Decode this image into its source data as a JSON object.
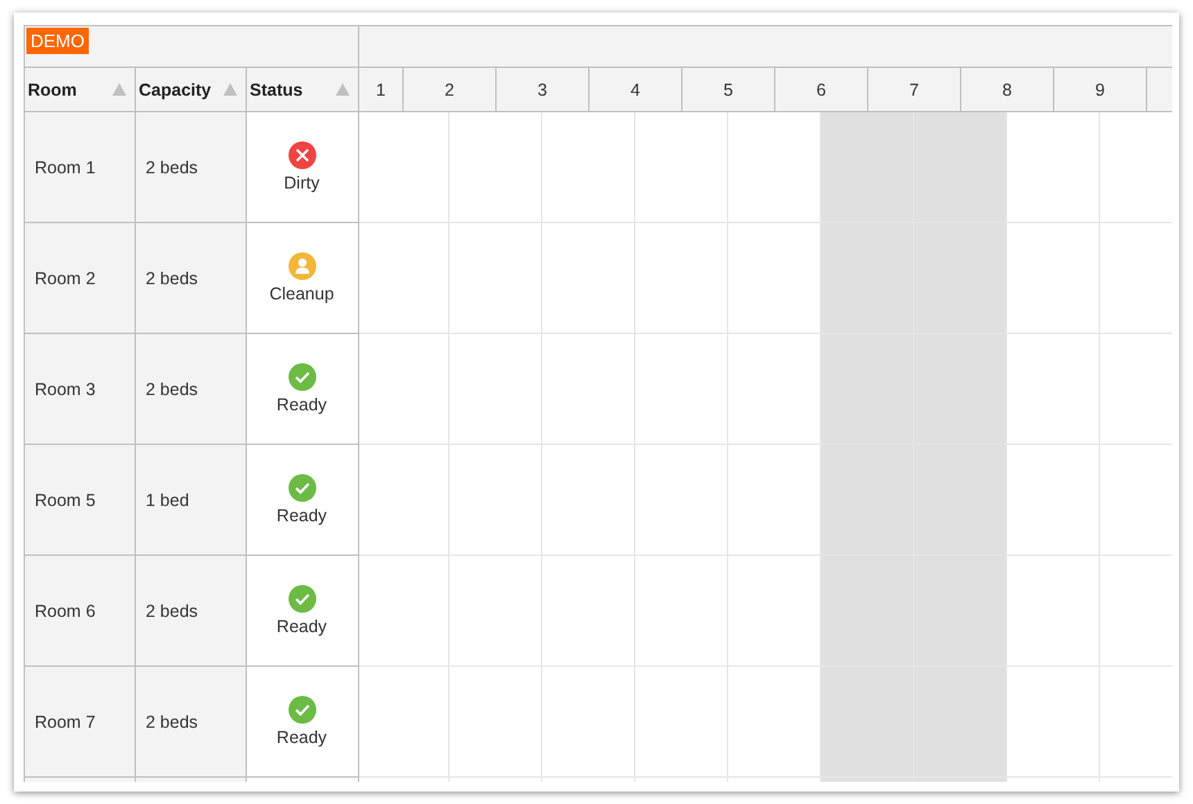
{
  "badge": "DEMO",
  "columns": [
    {
      "label": "Room"
    },
    {
      "label": "Capacity"
    },
    {
      "label": "Status"
    }
  ],
  "days": [
    "1",
    "2",
    "3",
    "4",
    "5",
    "6",
    "7",
    "8",
    "9"
  ],
  "timeline_cells": [
    {
      "weekend": false
    },
    {
      "weekend": false
    },
    {
      "weekend": false
    },
    {
      "weekend": false
    },
    {
      "weekend": false
    },
    {
      "weekend": true
    },
    {
      "weekend": true
    },
    {
      "weekend": false
    },
    {
      "weekend": false
    }
  ],
  "rows": [
    {
      "room": "Room 1",
      "capacity": "2 beds",
      "status": "Dirty",
      "kind": "dirty"
    },
    {
      "room": "Room 2",
      "capacity": "2 beds",
      "status": "Cleanup",
      "kind": "cleanup"
    },
    {
      "room": "Room 3",
      "capacity": "2 beds",
      "status": "Ready",
      "kind": "ready"
    },
    {
      "room": "Room 5",
      "capacity": "1 bed",
      "status": "Ready",
      "kind": "ready"
    },
    {
      "room": "Room 6",
      "capacity": "2 beds",
      "status": "Ready",
      "kind": "ready"
    },
    {
      "room": "Room 7",
      "capacity": "2 beds",
      "status": "Ready",
      "kind": "ready"
    }
  ]
}
